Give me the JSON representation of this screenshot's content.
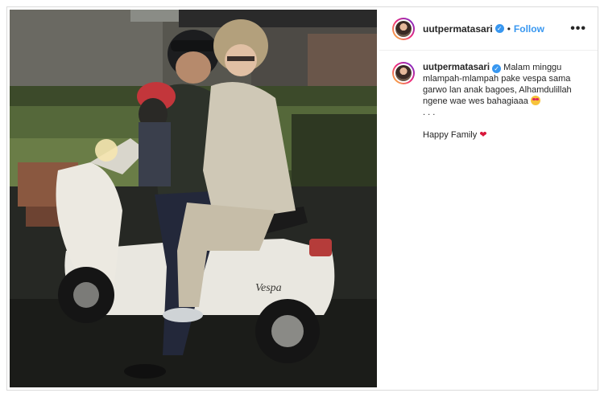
{
  "post": {
    "username": "uutpermatasari",
    "separator": "•",
    "follow_label": "Follow",
    "more_label": "•••",
    "caption_lines": [
      "Malam minggu",
      "mlampah-mlampah pake vespa sama",
      "garwo lan anak bagoes, Alhamdulillah",
      "ngene wae wes bahagiaaa"
    ],
    "caption_ellipsis": ". . .",
    "caption_tagline": "Happy Family",
    "photo_text": "Vespa"
  },
  "icons": {
    "verified": "verified-badge-icon",
    "more": "more-options-icon",
    "emoji": "star-struck-emoji-icon",
    "heart": "red-heart-icon"
  },
  "colors": {
    "accent": "#3897f0",
    "heart": "#d8163a",
    "border": "#dbdbdb"
  }
}
